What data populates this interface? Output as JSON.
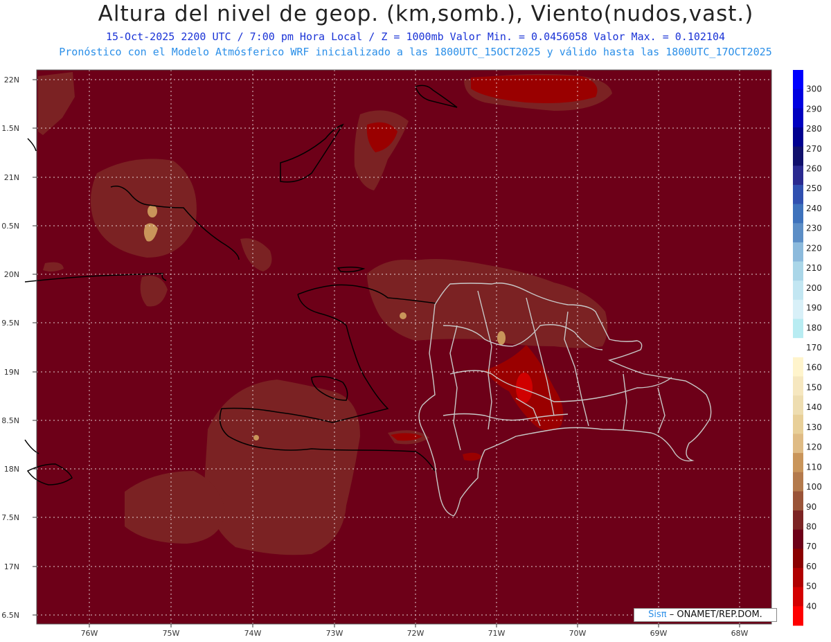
{
  "header": {
    "title": "Altura del nivel de geop. (km,somb.), Viento(nudos,vast.)",
    "subtitle_1": "15-Oct-2025  2200 UTC / 7:00 pm Hora Local / Z = 1000mb  Valor Min. = 0.0456058  Valor Max. = 0.102104",
    "subtitle_2": "Pronóstico con el Modelo Atmósferico WRF inicializado a las 1800UTC_15OCT2025 y válido hasta las  1800UTC_17OCT2025"
  },
  "credit": {
    "sis": "Sisπ",
    "rest": "– ONAMET/REP.DOM."
  },
  "colors": {
    "background_field": "#6d0018",
    "land_border": "#000000",
    "province_border": "#c0c0c0"
  },
  "map": {
    "lat_labels": [
      "22N",
      "1.5N",
      "21N",
      "0.5N",
      "20N",
      "9.5N",
      "19N",
      "8.5N",
      "18N",
      "7.5N",
      "17N",
      "6.5N"
    ],
    "lon_labels": [
      "76W",
      "75W",
      "74W",
      "73W",
      "72W",
      "71W",
      "70W",
      "69W",
      "68W"
    ]
  },
  "chart_data": {
    "type": "heatmap",
    "colorbar": {
      "levels": [
        "300",
        "290",
        "280",
        "270",
        "260",
        "250",
        "240",
        "230",
        "220",
        "210",
        "200",
        "190",
        "180",
        "170",
        "160",
        "150",
        "140",
        "130",
        "120",
        "110",
        "100",
        "90",
        "80",
        "70",
        "60",
        "50",
        "40"
      ],
      "colors": [
        "#0000ff",
        "#0000e0",
        "#0000c0",
        "#000090",
        "#10106c",
        "#2a2a90",
        "#3050b0",
        "#3e72bc",
        "#5c8ec6",
        "#8cbadc",
        "#aad6e8",
        "#c2e6f2",
        "#d8f0f8",
        "#b8ecf2",
        "#ffffff",
        "#fff4cc",
        "#f6e7bf",
        "#eeddb0",
        "#e8cf98",
        "#dfbb84",
        "#c9955a",
        "#b47a4c",
        "#9a5438",
        "#7c2424",
        "#6d0018",
        "#8a0000",
        "#b00000",
        "#d40000",
        "#ff0000"
      ]
    }
  }
}
